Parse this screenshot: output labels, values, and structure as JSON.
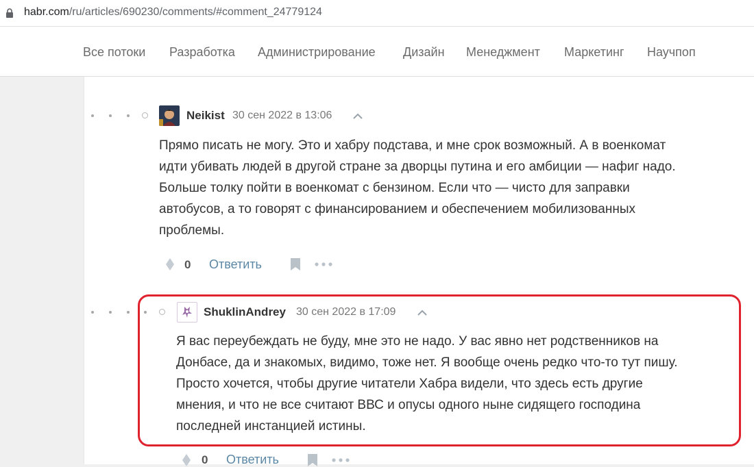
{
  "browser": {
    "url_host": "habr.com",
    "url_path": "/ru/articles/690230/comments/#comment_24779124"
  },
  "nav": {
    "items": [
      "Все потоки",
      "Разработка",
      "Администрирование",
      "Дизайн",
      "Менеджмент",
      "Маркетинг",
      "Научпоп"
    ]
  },
  "comments": [
    {
      "username": "Neikist",
      "timestamp": "30 сен 2022 в 13:06",
      "lines": [
        "Прямо писать не могу. Это и хабру подстава, и мне срок возможный. А в военкомат",
        "идти убивать людей в другой стране за дворцы путина и его амбиции — нафиг надо.",
        "Больше толку пойти в военкомат с бензином. Если что — чисто для заправки",
        "автобусов, а то говорят с финансированием и обеспечением мобилизованных",
        "проблемы."
      ],
      "score": "0",
      "reply_label": "Ответить",
      "icons": [
        "vote-icon",
        "bookmark-icon",
        "more-icon",
        "chevron-up-icon"
      ]
    },
    {
      "username": "ShuklinAndrey",
      "timestamp": "30 сен 2022 в 17:09",
      "lines": [
        "Я вас переубеждать не буду, мне это не надо. У вас явно нет родственников на",
        "Донбасе, да и знакомых, видимо, тоже нет. Я вообще очень редко что-то тут пишу.",
        "Просто хочется, чтобы другие читатели Хабра видели, что здесь есть другие",
        "мнения, и что не все считают ВВС и опусы одного ныне сидящего господина",
        "последней инстанцией истины."
      ],
      "score": "0",
      "reply_label": "Ответить",
      "icons": [
        "vote-icon",
        "bookmark-icon",
        "more-icon",
        "chevron-up-icon"
      ]
    }
  ],
  "colors": {
    "highlight": "#e0212e",
    "link": "#5b87a6",
    "page_bg": "#f0f0f1"
  }
}
